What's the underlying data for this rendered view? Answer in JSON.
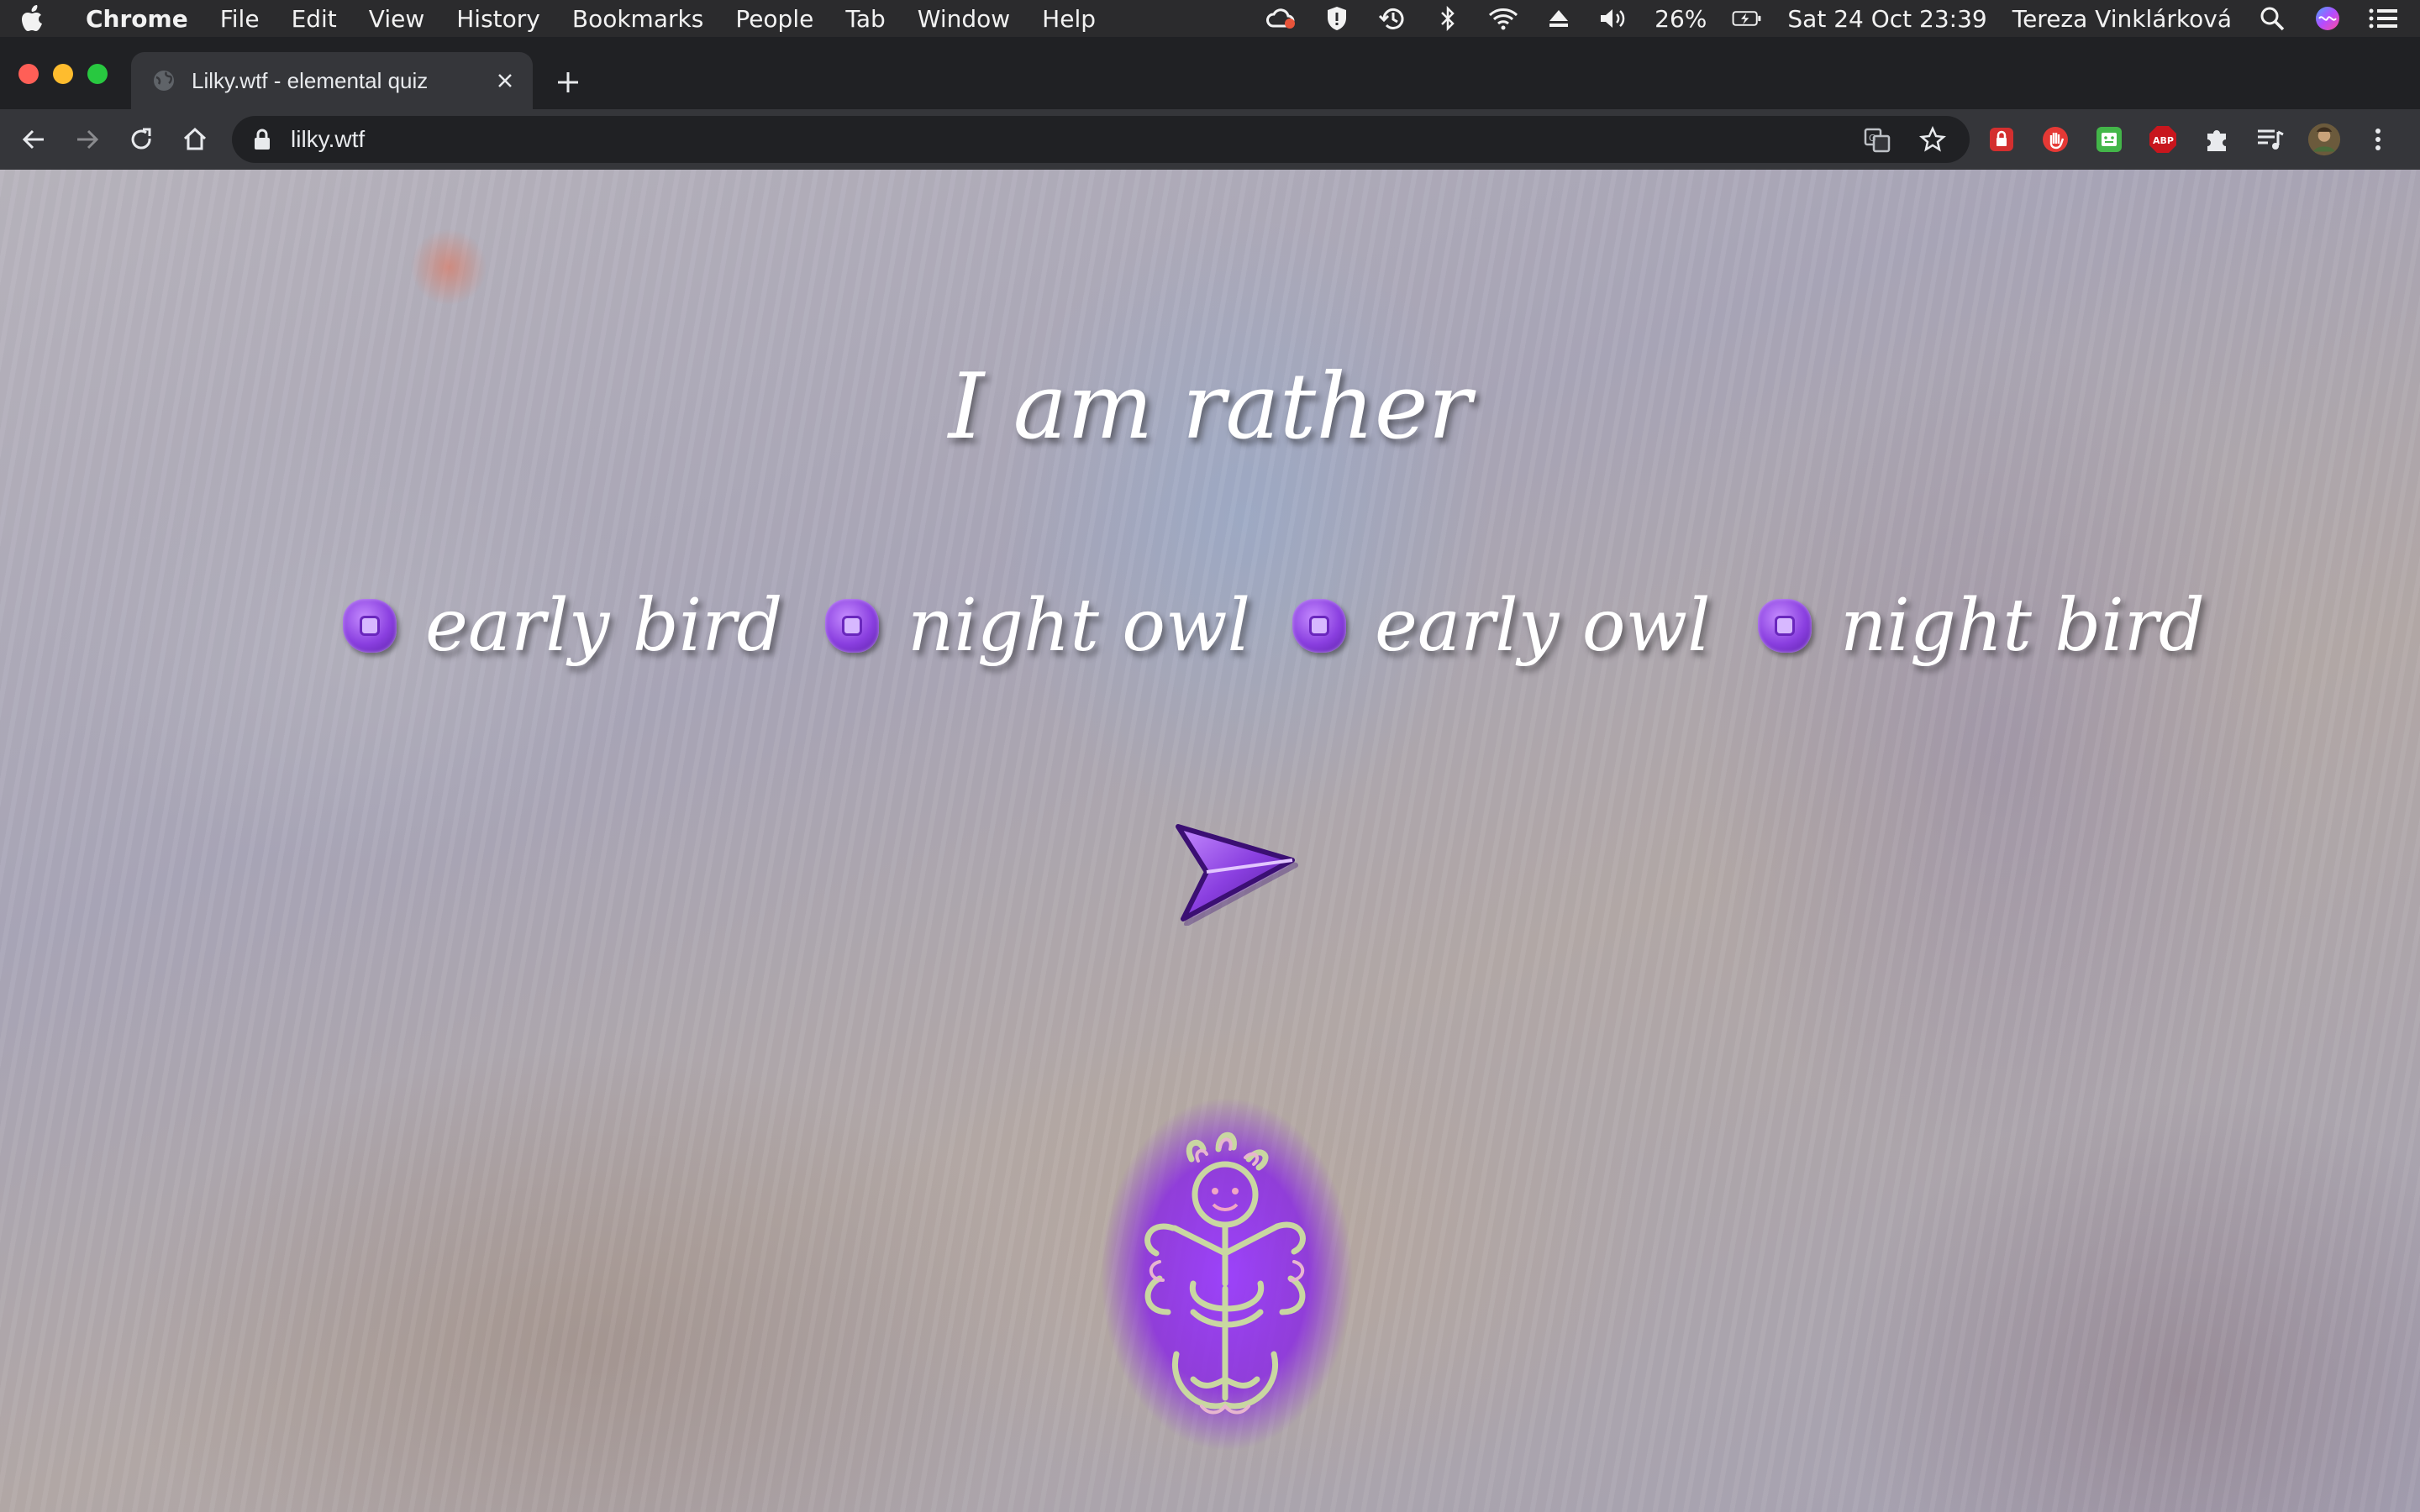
{
  "menubar": {
    "app_name": "Chrome",
    "menus": [
      "File",
      "Edit",
      "View",
      "History",
      "Bookmarks",
      "People",
      "Tab",
      "Window",
      "Help"
    ],
    "battery": "26%",
    "datetime": "Sat 24 Oct  23:39",
    "user": "Tereza Vinklárková"
  },
  "tab": {
    "title": "Lilky.wtf - elemental quiz"
  },
  "toolbar": {
    "url": "lilky.wtf"
  },
  "quiz": {
    "question": "I am rather",
    "options": [
      "early bird",
      "night owl",
      "early owl",
      "night bird"
    ]
  },
  "colors": {
    "accent_purple": "#8a3fe0",
    "chrome_dark": "#202124",
    "chrome_toolbar": "#35363a"
  },
  "icons": {
    "submit": "paper-plane-arrow-icon",
    "mascot": "flower-figure-illustration"
  }
}
